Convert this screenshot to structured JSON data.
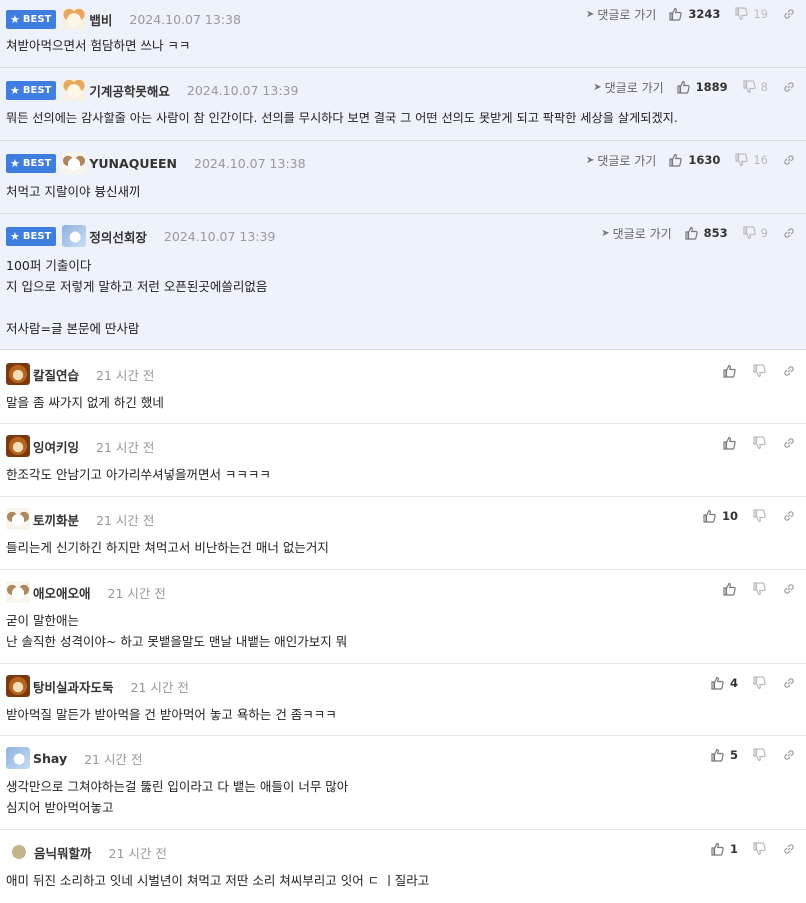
{
  "ui": {
    "best_label": "BEST",
    "reply_label": "댓글로 가기"
  },
  "best_comments": [
    {
      "avatar": "dog-avatar",
      "nick": "뱁비",
      "date": "2024.10.07 13:38",
      "likes": "3243",
      "dislikes": "19",
      "lines": [
        "쳐받아먹으면서 험담하면 쓰나 ㅋㅋ"
      ]
    },
    {
      "avatar": "dog-avatar",
      "nick": "기계공학못해요",
      "date": "2024.10.07 13:39",
      "likes": "1889",
      "dislikes": "8",
      "lines": [
        "뭐든 선의에는 감사할줄 아는 사람이 참 인간이다. 선의를 무시하다 보면 결국 그 어떤 선의도 못받게 되고 팍팍한 세상을 살게되겠지."
      ]
    },
    {
      "avatar": "puppy-avatar",
      "nick": "YUNAQUEEN",
      "date": "2024.10.07 13:38",
      "likes": "1630",
      "dislikes": "16",
      "lines": [
        "처먹고 지랄이야 븅신새끼"
      ]
    },
    {
      "avatar": "blue-avatar",
      "nick": "정의선회장",
      "date": "2024.10.07 13:39",
      "likes": "853",
      "dislikes": "9",
      "lines": [
        "100퍼 기출이다",
        "지 입으로 저렇게 말하고 저런 오픈된곳에쓸리없음",
        "",
        "저사람=글 본문에 딴사람"
      ]
    }
  ],
  "comments": [
    {
      "avatar": "lion-avatar",
      "nick": "칼질연습",
      "time": "21 시간 전",
      "likes": "",
      "lines": [
        "말을 좀 싸가지 없게 하긴 했네"
      ]
    },
    {
      "avatar": "lion-avatar",
      "nick": "잉여키잉",
      "time": "21 시간 전",
      "likes": "",
      "lines": [
        "한조각도 안남기고 아가리쑤셔넣을꺼면서 ㅋㅋㅋㅋ"
      ]
    },
    {
      "avatar": "puppy-avatar",
      "nick": "토끼화분",
      "time": "21 시간 전",
      "likes": "10",
      "lines": [
        "들리는게 신기하긴 하지만 쳐먹고서 비난하는건 매너 없는거지"
      ]
    },
    {
      "avatar": "puppy-avatar",
      "nick": "애오애오애",
      "time": "21 시간 전",
      "likes": "",
      "lines": [
        "굳이 말한애는",
        "난 솔직한 성격이야~ 하고 못뱉을말도 맨날 내뱉는 애인가보지 뭐"
      ]
    },
    {
      "avatar": "lion-avatar",
      "nick": "탕비실과자도둑",
      "time": "21 시간 전",
      "likes": "4",
      "lines": [
        "받아먹질 말든가 받아먹을 건 받아먹어 놓고 욕하는 건 좀ㅋㅋㅋ"
      ]
    },
    {
      "avatar": "blue-avatar",
      "nick": "Shay",
      "time": "21 시간 전",
      "likes": "5",
      "lines": [
        "생각만으로 그쳐야하는걸 뚫린 입이라고 다 뱉는 애들이 너무 많아",
        "심지어 받아먹어놓고"
      ]
    },
    {
      "avatar": "circle-avatar",
      "nick": "음닉뭐할까",
      "time": "21 시간 전",
      "likes": "1",
      "lines": [
        "애미 뒤진 소리하고 잇네 시벌년이 쳐먹고 저딴 소리 쳐씨부리고 잇어 ㄷ ㅣ질라고"
      ]
    }
  ]
}
